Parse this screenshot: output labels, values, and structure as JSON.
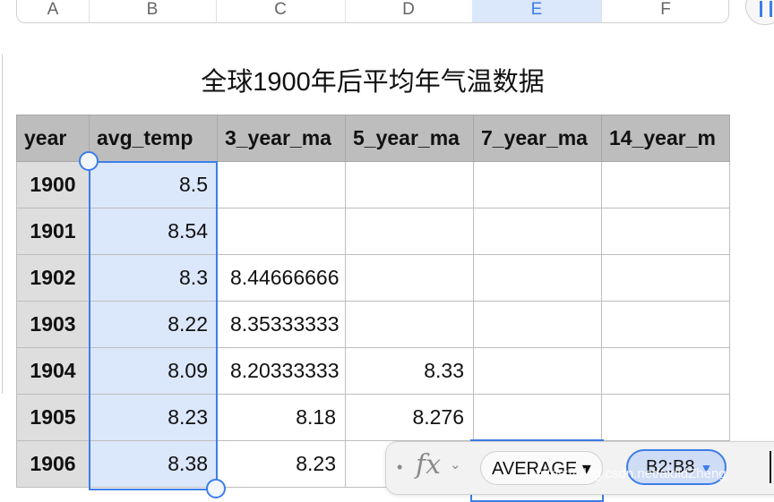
{
  "columns": [
    "A",
    "B",
    "C",
    "D",
    "E",
    "F"
  ],
  "selected_column": "E",
  "sheet_title": "全球1900年后平均年气温数据",
  "headers": [
    "year",
    "avg_temp",
    "3_year_ma",
    "5_year_ma",
    "7_year_ma",
    "14_year_m"
  ],
  "rows": [
    [
      "1900",
      "8.5",
      "",
      "",
      "",
      ""
    ],
    [
      "1901",
      "8.54",
      "",
      "",
      "",
      ""
    ],
    [
      "1902",
      "8.3",
      "8.44666666",
      "",
      "",
      ""
    ],
    [
      "1903",
      "8.22",
      "8.35333333",
      "",
      "",
      ""
    ],
    [
      "1904",
      "8.09",
      "8.20333333",
      "8.33",
      "",
      ""
    ],
    [
      "1905",
      "8.23",
      "8.18",
      "8.276",
      "",
      ""
    ],
    [
      "1906",
      "8.38",
      "8.23",
      "",
      "",
      ""
    ]
  ],
  "formula_bar": {
    "fx_label": "fx",
    "function_name": "AVERAGE",
    "range_ref": "B2:B8"
  },
  "watermark": "https://blog.csdn.net/aidldZheng",
  "icons": {
    "pause": "pause-icon",
    "fx": "function-icon",
    "chevron": "chevron-down-icon",
    "dropdown": "triangle-down-icon"
  },
  "colors": {
    "accent": "#3d7de8",
    "selection_fill": "#dbe7fb",
    "header_fill": "#bdbdbd",
    "row_header_fill": "#dedede"
  }
}
